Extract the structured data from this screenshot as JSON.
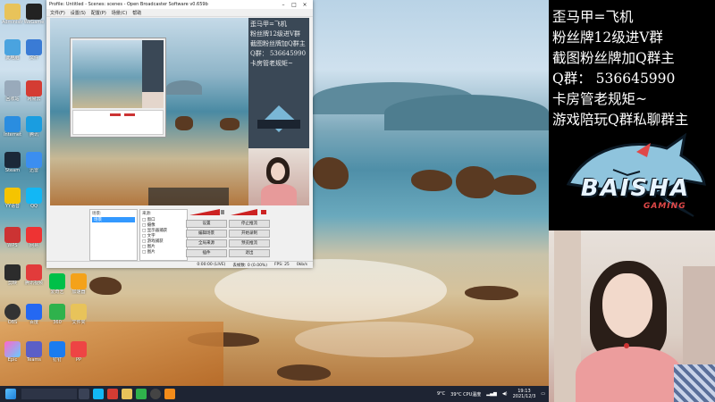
{
  "obs": {
    "title": "Profile: Untitled - Scenes: scenes - Open Broadcaster Software v0.659b",
    "menu": [
      "文件(F)",
      "设置(S)",
      "配置(P)",
      "场景(C)",
      "帮助"
    ],
    "scenes_header": "场景:",
    "sources_header": "来源:",
    "scene_item": "场景",
    "sources": [
      "□ 窗口",
      "□ 摄像",
      "□ 显示器捕获",
      "□ 文字",
      "□ 游戏捕获",
      "□ 图片",
      "□ 图片"
    ],
    "buttons": [
      "设置",
      "停止推流",
      "编辑场景",
      "开始录制",
      "全局来源",
      "预览推流",
      "插件",
      "退出"
    ],
    "status": [
      "0:00:00 (LIVE)",
      "丢帧数: 0 (0.00%)",
      "FPS: 25",
      "0kb/s"
    ]
  },
  "overlay_text": [
    "歪马甲=飞机",
    "粉丝牌12级进V群",
    "截图粉丝牌加Q群主",
    "Q群： 536645990",
    "卡房管老规矩~",
    "游戏陪玩Q群私聊群主"
  ],
  "logo": {
    "title": "BAISHA",
    "subtitle": "GAMING"
  },
  "desktop_icons": [
    "Administr",
    "WeGame",
    "此电脑",
    "文件",
    "回收站",
    "网易云",
    "Internet",
    "腾讯",
    "Steam",
    "迅雷",
    "YY语音",
    "QQ",
    "WPS",
    "网易",
    "剪映",
    "腾讯视频",
    "爱奇艺",
    "加速器",
    "OBS",
    "百度",
    "360",
    "文件夹",
    "Epic",
    "Teams",
    "钉钉",
    "PP"
  ],
  "taskbar": {
    "weather": "9°C",
    "cpu": "39°C CPU温度",
    "time": "19:13",
    "date": "2021/12/3"
  }
}
